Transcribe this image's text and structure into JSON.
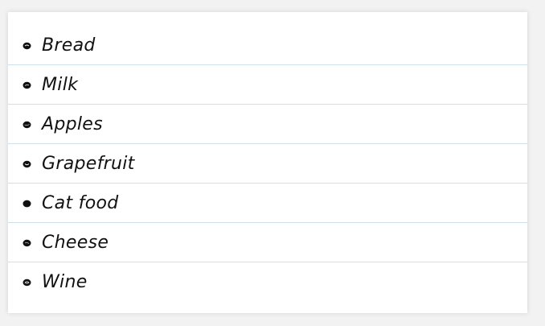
{
  "list": {
    "items": [
      {
        "label": "Bread"
      },
      {
        "label": "Milk"
      },
      {
        "label": "Apples"
      },
      {
        "label": "Grapefruit"
      },
      {
        "label": "Cat food"
      },
      {
        "label": "Cheese"
      },
      {
        "label": "Wine"
      }
    ]
  },
  "icons": {
    "bullet": "scribble-bullet-icon"
  },
  "colors": {
    "background": "#f2f2f2",
    "card": "#ffffff",
    "divider": "#cfe0ea",
    "text": "#111111"
  }
}
